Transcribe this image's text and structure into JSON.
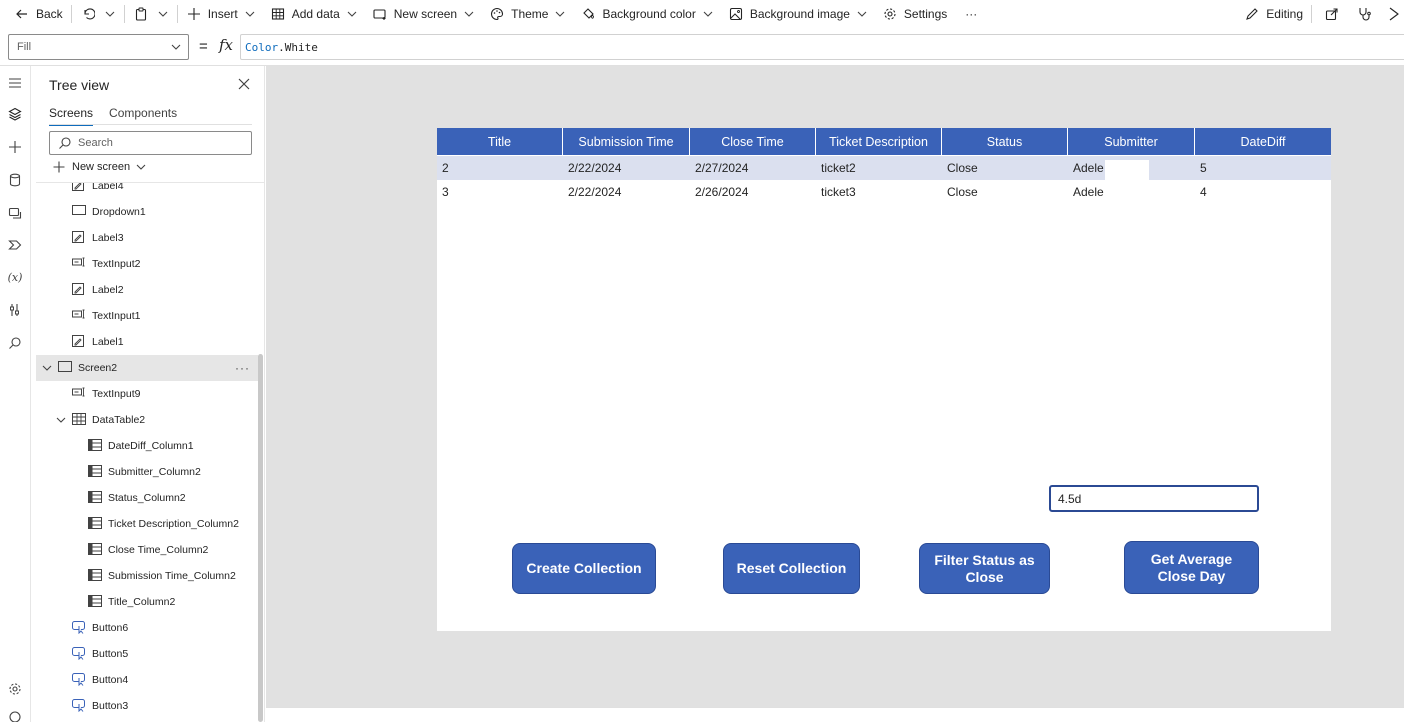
{
  "toolbar": {
    "back": "Back",
    "insert": "Insert",
    "add_data": "Add data",
    "new_screen": "New screen",
    "theme": "Theme",
    "background_color": "Background color",
    "background_image": "Background image",
    "settings": "Settings",
    "more": "···",
    "editing": "Editing"
  },
  "formula_bar": {
    "property": "Fill",
    "equals": "=",
    "fx": "fx",
    "formula_keyword": "Color",
    "formula_rest": ".White"
  },
  "tree": {
    "title": "Tree view",
    "tabs": [
      "Screens",
      "Components"
    ],
    "search_placeholder": "Search",
    "new_screen": "New screen",
    "nodes": [
      {
        "label": "Label4",
        "icon": "label-icon",
        "indent": 1
      },
      {
        "label": "Dropdown1",
        "icon": "dropdown-icon",
        "indent": 1
      },
      {
        "label": "Label3",
        "icon": "label-icon",
        "indent": 1
      },
      {
        "label": "TextInput2",
        "icon": "textinput-icon",
        "indent": 1
      },
      {
        "label": "Label2",
        "icon": "label-icon",
        "indent": 1
      },
      {
        "label": "TextInput1",
        "icon": "textinput-icon",
        "indent": 1
      },
      {
        "label": "Label1",
        "icon": "label-icon",
        "indent": 1
      },
      {
        "label": "Screen2",
        "icon": "screen-icon",
        "indent": 0,
        "selected": true
      },
      {
        "label": "TextInput9",
        "icon": "textinput-icon",
        "indent": 1
      },
      {
        "label": "DataTable2",
        "icon": "datatable-icon",
        "indent": 1,
        "expandable": true
      },
      {
        "label": "DateDiff_Column1",
        "icon": "column-icon",
        "indent": 2
      },
      {
        "label": "Submitter_Column2",
        "icon": "column-icon",
        "indent": 2
      },
      {
        "label": "Status_Column2",
        "icon": "column-icon",
        "indent": 2
      },
      {
        "label": "Ticket Description_Column2",
        "icon": "column-icon",
        "indent": 2
      },
      {
        "label": "Close Time_Column2",
        "icon": "column-icon",
        "indent": 2
      },
      {
        "label": "Submission Time_Column2",
        "icon": "column-icon",
        "indent": 2
      },
      {
        "label": "Title_Column2",
        "icon": "column-icon",
        "indent": 2
      },
      {
        "label": "Button6",
        "icon": "button-icon",
        "indent": 1
      },
      {
        "label": "Button5",
        "icon": "button-icon",
        "indent": 1
      },
      {
        "label": "Button4",
        "icon": "button-icon",
        "indent": 1
      },
      {
        "label": "Button3",
        "icon": "button-icon",
        "indent": 1
      }
    ]
  },
  "table": {
    "headers": [
      "Title",
      "Submission Time",
      "Close Time",
      "Ticket Description",
      "Status",
      "Submitter",
      "DateDiff"
    ],
    "rows": [
      [
        "2",
        "2/22/2024",
        "2/27/2024",
        "ticket2",
        "Close",
        "Adele",
        "5"
      ],
      [
        "3",
        "2/22/2024",
        "2/26/2024",
        "ticket3",
        "Close",
        "Adele",
        "4"
      ]
    ]
  },
  "text_input": {
    "value": "4.5d"
  },
  "buttons": {
    "create": "Create Collection",
    "reset": "Reset Collection",
    "filter": "Filter Status as Close",
    "average": "Get Average Close Day"
  },
  "colors": {
    "accent": "#3a62b8",
    "selected_row": "#dbe0ef",
    "canvas_bg": "#e1e1e1"
  }
}
